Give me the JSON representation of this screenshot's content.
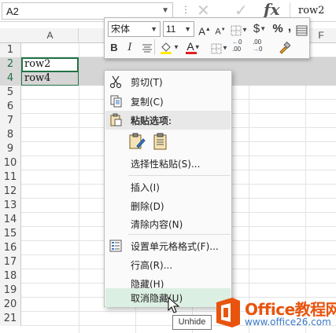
{
  "formula_bar": {
    "name_box": "A2",
    "formula_value": "row2"
  },
  "grid": {
    "columns": [
      "A",
      "",
      "",
      "",
      "",
      "F"
    ],
    "row_numbers": [
      "1",
      "2",
      "4",
      "5",
      "6",
      "7",
      "8",
      "9",
      "10",
      "11",
      "12",
      "13",
      "14",
      "15",
      "16",
      "17",
      "18",
      "19",
      "20",
      "21"
    ],
    "cells": {
      "A2": "row2",
      "A4": "row4"
    }
  },
  "mini_toolbar": {
    "font_name": "宋体",
    "font_size": "11",
    "grow_font": "A",
    "shrink_font": "A",
    "currency": "$",
    "percent": "%",
    "comma": ",",
    "bold": "B",
    "italic": "I",
    "font_color": "A",
    "dec_increase": ".00",
    "dec_decrease": ".00",
    "accent_yellow": "#ffeb00",
    "accent_red": "#e01e1e"
  },
  "context_menu": {
    "items": [
      {
        "label": "剪切(T)",
        "icon": "scissors-icon"
      },
      {
        "label": "复制(C)",
        "icon": "copy-icon"
      },
      {
        "label": "粘贴选项:",
        "icon": "clipboard-icon"
      },
      {
        "label": "选择性粘贴(S)...",
        "icon": ""
      },
      {
        "label": "插入(I)",
        "icon": ""
      },
      {
        "label": "删除(D)",
        "icon": ""
      },
      {
        "label": "清除内容(N)",
        "icon": ""
      },
      {
        "label": "设置单元格格式(F)...",
        "icon": "format-cells-icon"
      },
      {
        "label": "行高(R)...",
        "icon": ""
      },
      {
        "label": "隐藏(H)",
        "icon": ""
      },
      {
        "label": "取消隐藏(U)",
        "icon": ""
      }
    ],
    "hover_color": "#dcefe3"
  },
  "tooltip": "Unhide",
  "watermark": {
    "brand": "Office教程网",
    "url": "www.office26.com"
  }
}
